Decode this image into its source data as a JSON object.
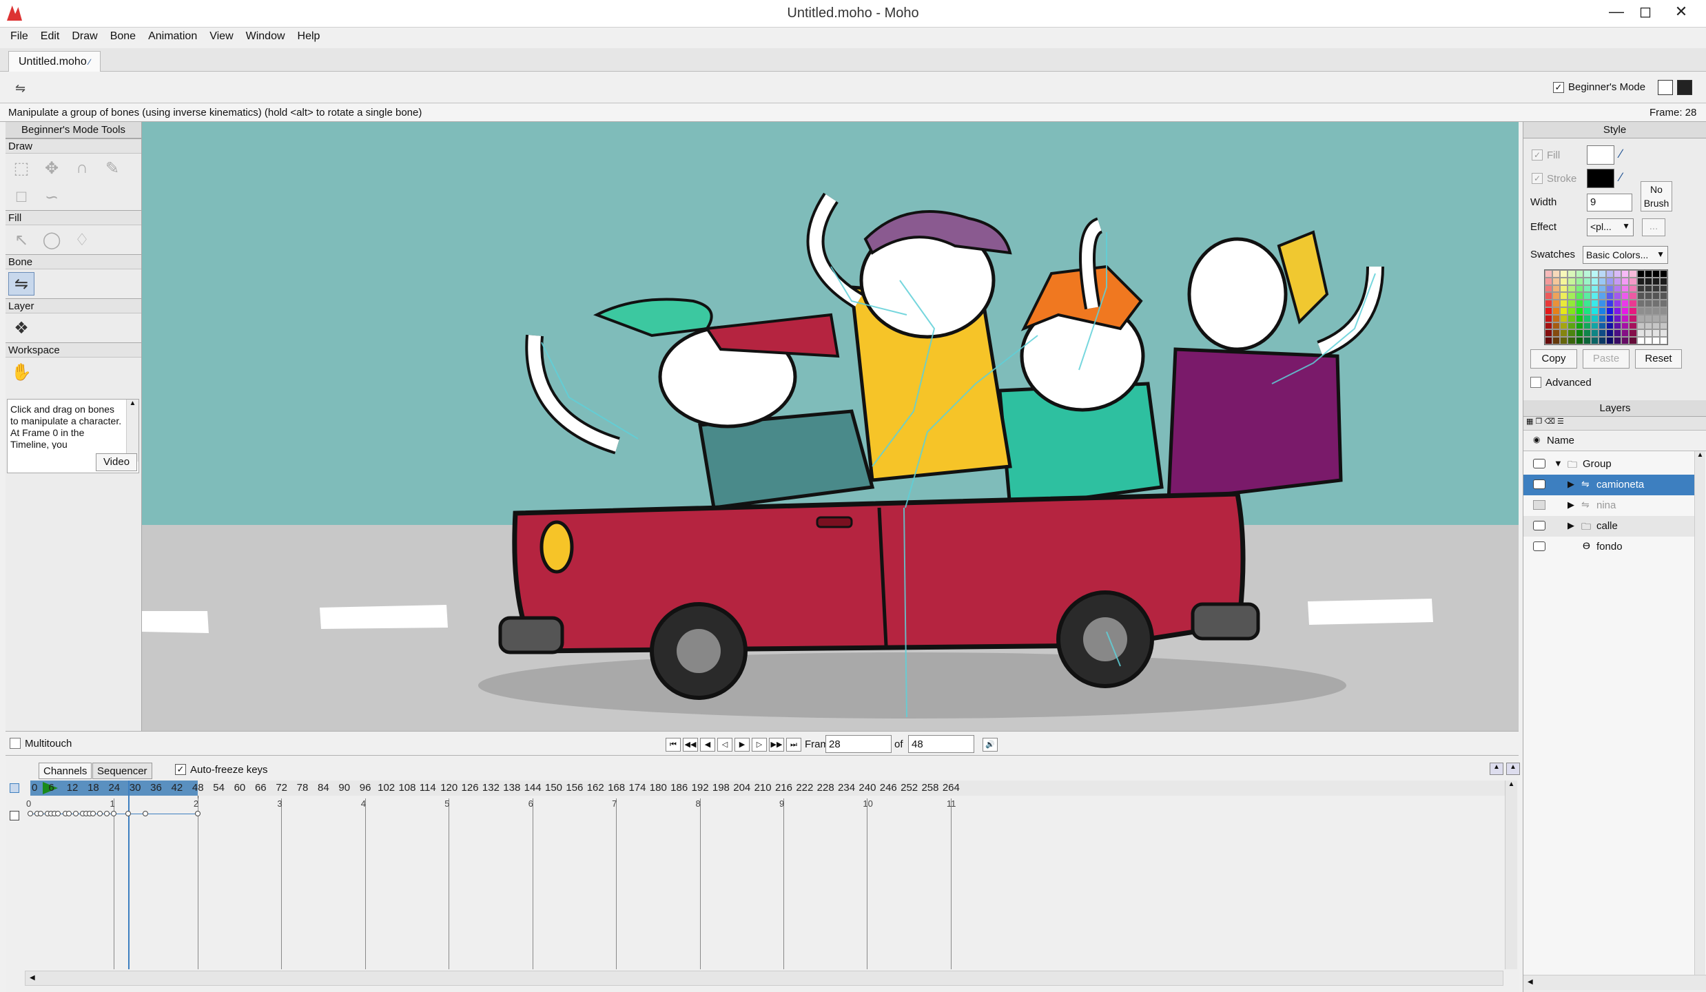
{
  "app": {
    "title": "Untitled.moho - Moho",
    "doc_tab": "Untitled.moho",
    "menu": [
      "File",
      "Edit",
      "Draw",
      "Bone",
      "Animation",
      "View",
      "Window",
      "Help"
    ],
    "beginners_mode_label": "Beginner's Mode",
    "status_text": "Manipulate a group of bones (using inverse kinematics) (hold <alt> to rotate a single bone)",
    "frame_status": "Frame: 28"
  },
  "tools_panel": {
    "title": "Beginner's Mode Tools",
    "sections": [
      "Draw",
      "Fill",
      "Bone",
      "Layer",
      "Workspace"
    ],
    "help_text": "Click and drag on bones to manipulate a character. At Frame 0 in the Timeline, you",
    "video_button": "Video",
    "multitouch_label": "Multitouch"
  },
  "style_panel": {
    "title": "Style",
    "fill_label": "Fill",
    "stroke_label": "Stroke",
    "width_label": "Width",
    "width_value": "9",
    "effect_label": "Effect",
    "effect_value": "<pl...",
    "effect_more": "...",
    "no_brush_label": "No Brush",
    "swatches_label": "Swatches",
    "swatches_value": "Basic Colors...",
    "copy_button": "Copy",
    "paste_button": "Paste",
    "reset_button": "Reset",
    "advanced_label": "Advanced",
    "fill_color": "#ffffff",
    "stroke_color": "#000000"
  },
  "layers_panel": {
    "title": "Layers",
    "name_header": "Name",
    "layers": [
      {
        "name": "Group",
        "icon": "folder-icon",
        "expanded": true
      },
      {
        "name": "camioneta",
        "icon": "bone-layer-icon",
        "selected": true
      },
      {
        "name": "nina",
        "icon": "bone-layer-icon",
        "hidden": true
      },
      {
        "name": "calle",
        "icon": "folder-icon"
      },
      {
        "name": "fondo",
        "icon": "vector-layer-icon"
      }
    ]
  },
  "playback": {
    "frame_label": "Frame",
    "frame_value": "28",
    "of_label": "of",
    "total_value": "48"
  },
  "timeline": {
    "tabs": [
      "Channels",
      "Sequencer"
    ],
    "autofreeze_label": "Auto-freeze keys",
    "start_tick": "0",
    "ticks": [
      "6",
      "12",
      "18",
      "24",
      "30",
      "36",
      "42",
      "48",
      "54",
      "60",
      "66",
      "72",
      "78",
      "84",
      "90",
      "96",
      "102",
      "108",
      "114",
      "120",
      "126",
      "132",
      "138",
      "144",
      "150",
      "156",
      "162",
      "168",
      "174",
      "180",
      "186",
      "192",
      "198",
      "204",
      "210",
      "216",
      "222",
      "228",
      "234",
      "240",
      "246",
      "252",
      "258",
      "264"
    ],
    "seconds": [
      "0",
      "1",
      "2",
      "3",
      "4",
      "5",
      "6",
      "7",
      "8",
      "9",
      "10",
      "11"
    ],
    "current_frame": 28,
    "range_end": 48
  },
  "colors": {
    "sky": "#7fbcba",
    "road": "#c8c8c8",
    "car": "#b52440",
    "selection": "#3d7fc0"
  }
}
